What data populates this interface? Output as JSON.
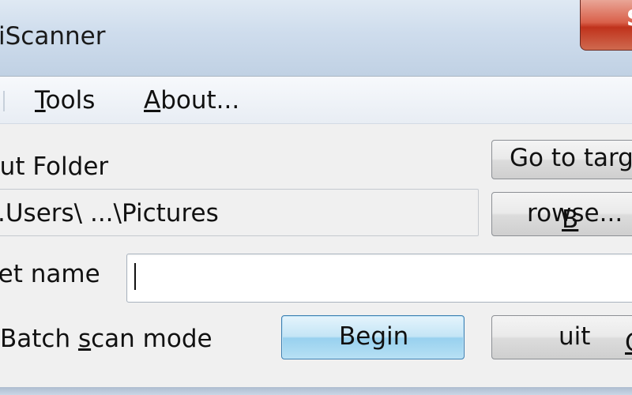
{
  "window": {
    "title": "iScanner",
    "close_glyph": "S"
  },
  "menu": {
    "items": [
      {
        "label": "Tools"
      },
      {
        "label": "About..."
      }
    ]
  },
  "form": {
    "input_folder_label": "put Folder",
    "input_folder_path": ".Users\\ ...\\Pictures",
    "target_name_label": "get name",
    "target_name_value": "",
    "batch_mode_label": "Batch scan mode"
  },
  "buttons": {
    "go_to_target": "Go to targe",
    "browse": "Browse...",
    "begin": "Begin",
    "quit": "Quit"
  },
  "colors": {
    "begin_button": "#98d1ef",
    "close_button": "#c0321c"
  }
}
